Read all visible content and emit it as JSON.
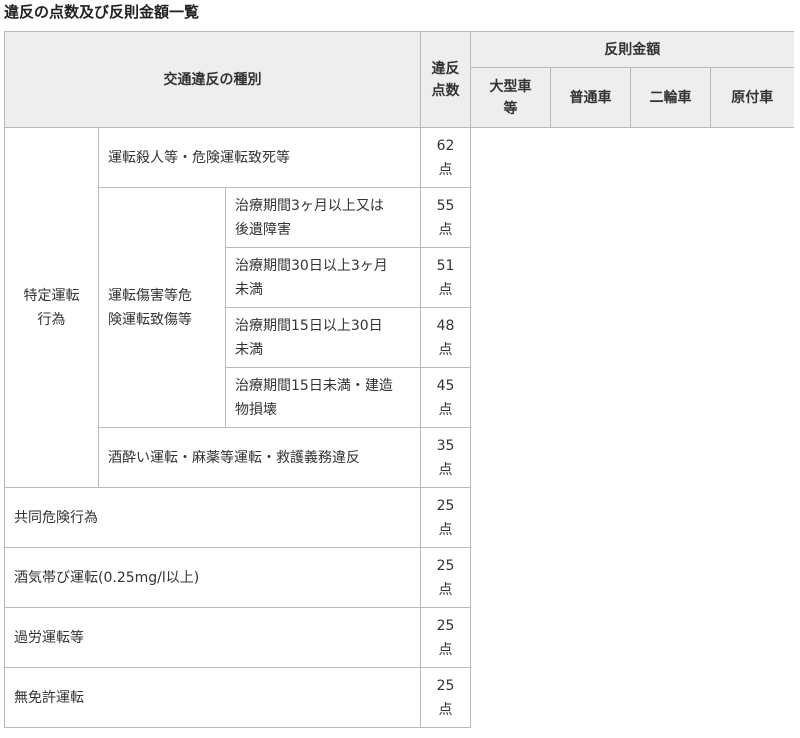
{
  "title": "違反の点数及び反則金額一覧",
  "header": {
    "violation_type": "交通違反の種別",
    "points_line1": "違反",
    "points_line2": "点数",
    "fine_amount": "反則金額",
    "large_vehicle_line1": "大型車",
    "large_vehicle_line2": "等",
    "standard_vehicle": "普通車",
    "two_wheel": "二輪車",
    "moped": "原付車"
  },
  "rows": {
    "specific_category_line1": "特定運転",
    "specific_category_line2": "行為",
    "homicide": {
      "label": "運転殺人等・危険運転致死等",
      "points_value": "62",
      "points_unit": "点"
    },
    "injury_category_line1": "運転傷害等危",
    "injury_category_line2": "険運転致傷等",
    "injury_3m": {
      "label_line1": "治療期間3ヶ月以上又は",
      "label_line2": "後遺障害",
      "points_value": "55",
      "points_unit": "点"
    },
    "injury_30d": {
      "label_line1": "治療期間30日以上3ヶ月",
      "label_line2": "未満",
      "points_value": "51",
      "points_unit": "点"
    },
    "injury_15d": {
      "label_line1": "治療期間15日以上30日",
      "label_line2": "未満",
      "points_value": "48",
      "points_unit": "点"
    },
    "injury_under15": {
      "label_line1": "治療期間15日未満・建造",
      "label_line2": "物損壊",
      "points_value": "45",
      "points_unit": "点"
    },
    "drunk_drugs": {
      "label": "酒酔い運転・麻薬等運転・救護義務違反",
      "points_value": "35",
      "points_unit": "点"
    },
    "joint_danger": {
      "label": "共同危険行為",
      "points_value": "25",
      "points_unit": "点"
    },
    "alcohol": {
      "label": "酒気帯び運転(0.25mg/l以上)",
      "points_value": "25",
      "points_unit": "点"
    },
    "fatigue": {
      "label": "過労運転等",
      "points_value": "25",
      "points_unit": "点"
    },
    "unlicensed": {
      "label": "無免許運転",
      "points_value": "25",
      "points_unit": "点"
    }
  }
}
